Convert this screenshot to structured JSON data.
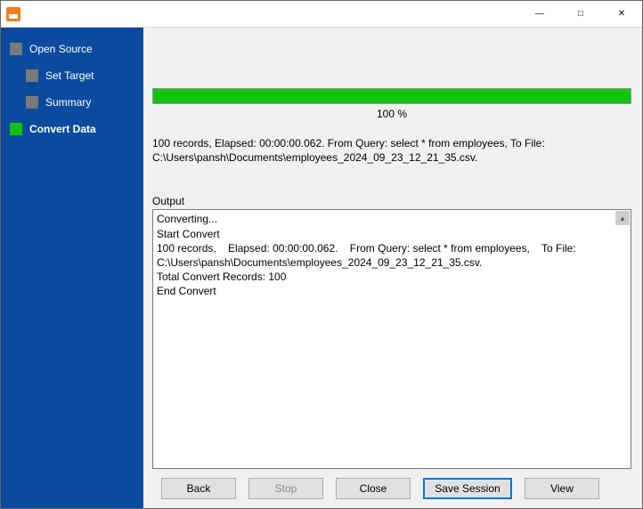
{
  "sidebar": {
    "items": [
      {
        "label": "Open Source",
        "active": false,
        "child": false
      },
      {
        "label": "Set Target",
        "active": false,
        "child": true
      },
      {
        "label": "Summary",
        "active": false,
        "child": true
      },
      {
        "label": "Convert Data",
        "active": true,
        "child": false
      }
    ]
  },
  "progress": {
    "percent_label": "100 %",
    "percent_value": 100
  },
  "summary": "100 records,    Elapsed: 00:00:00.062.    From Query: select * from employees,    To File: C:\\Users\\pansh\\Documents\\employees_2024_09_23_12_21_35.csv.",
  "output": {
    "label": "Output",
    "log": "Converting...\nStart Convert\n100 records,    Elapsed: 00:00:00.062.    From Query: select * from employees,    To File: C:\\Users\\pansh\\Documents\\employees_2024_09_23_12_21_35.csv.\nTotal Convert Records: 100\nEnd Convert"
  },
  "buttons": {
    "back": "Back",
    "stop": "Stop",
    "close": "Close",
    "save_session": "Save Session",
    "view": "View"
  }
}
